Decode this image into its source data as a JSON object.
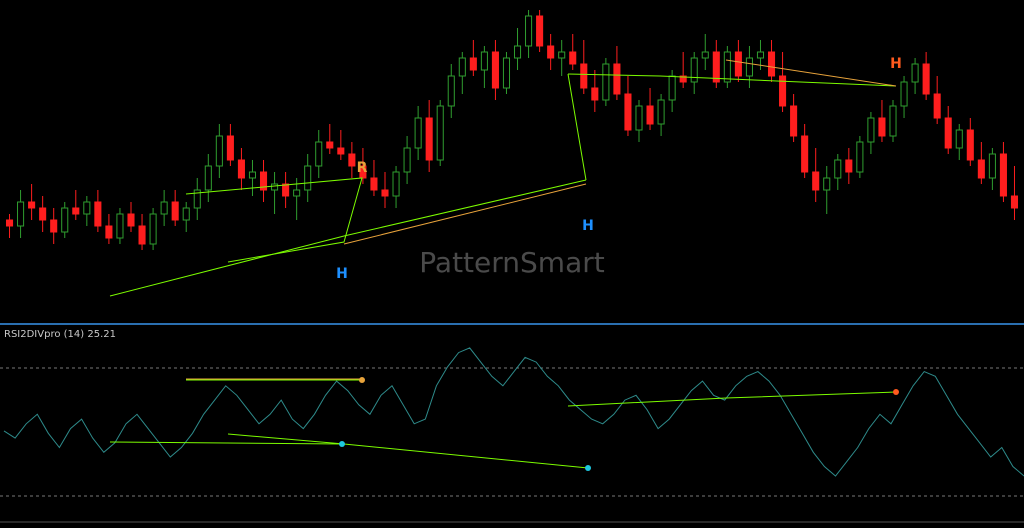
{
  "watermark": "PatternSmart",
  "indicator_label": "RSI2DIVpro (14) 25.21",
  "colors": {
    "background": "#000000",
    "bull_candle": "#2f9e2f",
    "bear_candle": "#ff1e1e",
    "divergence_line": "#7cfc00",
    "divergence_line_alt": "#e8a33b",
    "rsi_line": "#2e8b8b",
    "level_line": "#9a9a9a",
    "marker_R": "#e8a33b",
    "marker_H_blue": "#1e90ff",
    "marker_H_orange": "#ff5a1e"
  },
  "markers": [
    {
      "text": "R",
      "color": "marker_R"
    },
    {
      "text": "H",
      "color": "marker_H_blue"
    },
    {
      "text": "H",
      "color": "marker_H_blue"
    },
    {
      "text": "H",
      "color": "marker_H_orange"
    }
  ],
  "chart_data": [
    {
      "type": "candlestick",
      "title": "",
      "note": "prices estimated in relative units (no price axis shown)",
      "ylim": [
        0,
        100
      ],
      "candles": [
        [
          30,
          32,
          24,
          28
        ],
        [
          28,
          40,
          24,
          36
        ],
        [
          36,
          42,
          30,
          34
        ],
        [
          34,
          38,
          26,
          30
        ],
        [
          30,
          34,
          22,
          26
        ],
        [
          26,
          36,
          24,
          34
        ],
        [
          34,
          40,
          30,
          32
        ],
        [
          32,
          38,
          28,
          36
        ],
        [
          36,
          40,
          26,
          28
        ],
        [
          28,
          32,
          22,
          24
        ],
        [
          24,
          34,
          22,
          32
        ],
        [
          32,
          36,
          26,
          28
        ],
        [
          28,
          32,
          20,
          22
        ],
        [
          22,
          34,
          20,
          32
        ],
        [
          32,
          40,
          28,
          36
        ],
        [
          36,
          40,
          28,
          30
        ],
        [
          30,
          36,
          26,
          34
        ],
        [
          34,
          44,
          30,
          40
        ],
        [
          40,
          52,
          36,
          48
        ],
        [
          48,
          62,
          44,
          58
        ],
        [
          58,
          62,
          48,
          50
        ],
        [
          50,
          54,
          40,
          44
        ],
        [
          44,
          50,
          38,
          46
        ],
        [
          46,
          50,
          36,
          40
        ],
        [
          40,
          46,
          32,
          42
        ],
        [
          42,
          46,
          34,
          38
        ],
        [
          38,
          44,
          30,
          40
        ],
        [
          40,
          52,
          36,
          48
        ],
        [
          48,
          60,
          44,
          56
        ],
        [
          56,
          62,
          52,
          54
        ],
        [
          54,
          60,
          50,
          52
        ],
        [
          52,
          56,
          44,
          48
        ],
        [
          48,
          54,
          42,
          44
        ],
        [
          44,
          50,
          38,
          40
        ],
        [
          40,
          46,
          34,
          38
        ],
        [
          38,
          48,
          34,
          46
        ],
        [
          46,
          58,
          42,
          54
        ],
        [
          54,
          68,
          50,
          64
        ],
        [
          64,
          70,
          46,
          50
        ],
        [
          50,
          70,
          48,
          68
        ],
        [
          68,
          82,
          64,
          78
        ],
        [
          78,
          86,
          72,
          84
        ],
        [
          84,
          90,
          78,
          80
        ],
        [
          80,
          88,
          74,
          86
        ],
        [
          86,
          90,
          70,
          74
        ],
        [
          74,
          86,
          72,
          84
        ],
        [
          84,
          94,
          80,
          88
        ],
        [
          88,
          100,
          84,
          98
        ],
        [
          98,
          100,
          86,
          88
        ],
        [
          88,
          92,
          80,
          84
        ],
        [
          84,
          90,
          78,
          86
        ],
        [
          86,
          92,
          80,
          82
        ],
        [
          82,
          90,
          72,
          74
        ],
        [
          74,
          80,
          66,
          70
        ],
        [
          70,
          84,
          68,
          82
        ],
        [
          82,
          88,
          70,
          72
        ],
        [
          72,
          78,
          58,
          60
        ],
        [
          60,
          70,
          56,
          68
        ],
        [
          68,
          74,
          60,
          62
        ],
        [
          62,
          72,
          58,
          70
        ],
        [
          70,
          80,
          66,
          78
        ],
        [
          78,
          86,
          74,
          76
        ],
        [
          76,
          86,
          72,
          84
        ],
        [
          84,
          92,
          80,
          86
        ],
        [
          86,
          90,
          74,
          76
        ],
        [
          76,
          88,
          74,
          86
        ],
        [
          86,
          90,
          76,
          78
        ],
        [
          78,
          88,
          74,
          84
        ],
        [
          84,
          90,
          80,
          86
        ],
        [
          86,
          90,
          76,
          78
        ],
        [
          78,
          86,
          66,
          68
        ],
        [
          68,
          72,
          56,
          58
        ],
        [
          58,
          62,
          44,
          46
        ],
        [
          46,
          54,
          36,
          40
        ],
        [
          40,
          48,
          32,
          44
        ],
        [
          44,
          52,
          40,
          50
        ],
        [
          50,
          54,
          42,
          46
        ],
        [
          46,
          58,
          44,
          56
        ],
        [
          56,
          66,
          52,
          64
        ],
        [
          64,
          70,
          56,
          58
        ],
        [
          58,
          70,
          56,
          68
        ],
        [
          68,
          78,
          64,
          76
        ],
        [
          76,
          84,
          72,
          82
        ],
        [
          82,
          86,
          70,
          72
        ],
        [
          72,
          78,
          62,
          64
        ],
        [
          64,
          68,
          52,
          54
        ],
        [
          54,
          62,
          50,
          60
        ],
        [
          60,
          64,
          48,
          50
        ],
        [
          50,
          56,
          42,
          44
        ],
        [
          44,
          54,
          40,
          52
        ],
        [
          52,
          56,
          36,
          38
        ],
        [
          38,
          48,
          30,
          34
        ]
      ]
    },
    {
      "type": "line",
      "title": "",
      "series": [
        {
          "name": "RSI2DIVpro (14)",
          "values": [
            55,
            52,
            58,
            62,
            54,
            48,
            56,
            60,
            52,
            46,
            50,
            58,
            62,
            56,
            50,
            44,
            48,
            54,
            62,
            68,
            74,
            70,
            64,
            58,
            62,
            68,
            60,
            56,
            62,
            70,
            76,
            72,
            66,
            62,
            70,
            74,
            66,
            58,
            60,
            74,
            82,
            88,
            90,
            84,
            78,
            74,
            80,
            86,
            84,
            78,
            74,
            68,
            64,
            60,
            58,
            62,
            68,
            70,
            64,
            56,
            60,
            66,
            72,
            76,
            70,
            68,
            74,
            78,
            80,
            76,
            70,
            62,
            54,
            46,
            40,
            36,
            42,
            48,
            56,
            62,
            58,
            66,
            74,
            80,
            78,
            70,
            62,
            56,
            50,
            44,
            48,
            40,
            36
          ]
        }
      ],
      "levels": [
        70,
        30
      ],
      "last_value": 25.21
    }
  ]
}
